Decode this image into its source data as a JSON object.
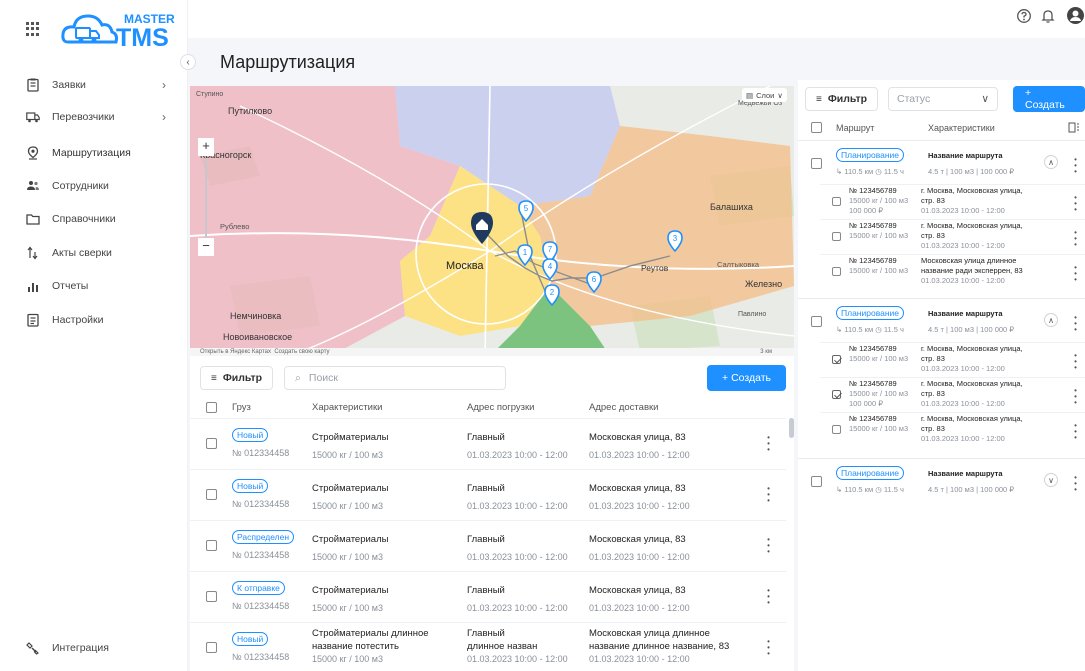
{
  "brand": {
    "logo_top": "MASTER",
    "logo_bottom": "TMS"
  },
  "sidebar": {
    "items": [
      {
        "label": "Заявки",
        "icon": "clipboard-icon",
        "has_arrow": true
      },
      {
        "label": "Перевозчики",
        "icon": "truck-icon",
        "has_arrow": true
      },
      {
        "label": "Маршрутизация",
        "icon": "location-pin-icon",
        "has_arrow": false
      },
      {
        "label": "Сотрудники",
        "icon": "people-icon",
        "has_arrow": false
      },
      {
        "label": "Справочники",
        "icon": "folder-icon",
        "has_arrow": false
      },
      {
        "label": "Акты сверки",
        "icon": "sort-arrows-icon",
        "has_arrow": false
      },
      {
        "label": "Отчеты",
        "icon": "bar-chart-icon",
        "has_arrow": false
      },
      {
        "label": "Настройки",
        "icon": "settings-list-icon",
        "has_arrow": false
      }
    ],
    "bottom_item": {
      "label": "Интеграция",
      "icon": "integration-icon"
    }
  },
  "page": {
    "title": "Маршрутизация"
  },
  "map": {
    "labels": {
      "putilkovo": "Путилково",
      "krasnogorsk": "Красногорск",
      "moscow": "Москва",
      "balashikha": "Балашиха",
      "reutov": "Реутов",
      "zheleznodorozhny": "Железно",
      "nemchinovka": "Немчиновка",
      "novoivanovskoe": "Новоивановское",
      "rublevo": "Рублево",
      "saltykovka": "Салтыковка",
      "layers": "Слои",
      "scale": "3 км",
      "open_maps": "Открыть в Яндекс Картах",
      "create_own_map": "Создать свою карту",
      "medvezhi": "Медвежьи Оз",
      "stupino": "Ступино",
      "pavlino": "Павлино"
    },
    "markers": [
      "1",
      "2",
      "3",
      "4",
      "5",
      "6",
      "7"
    ],
    "zoom_in": "+",
    "zoom_out": "−"
  },
  "orders": {
    "filter_label": "Фильтр",
    "search_placeholder": "Поиск",
    "create_label": "+ Создать",
    "columns": {
      "cargo": "Груз",
      "specs": "Характеристики",
      "load_addr": "Адрес погрузки",
      "delivery_addr": "Адрес доставки"
    },
    "rows": [
      {
        "status": "Новый",
        "number": "№ 012334458",
        "cargo": "Стройматериалы",
        "cargo2": "",
        "specs": "15000 кг / 100 м3",
        "load": "Главный",
        "load2": "",
        "load_time": "01.03.2023 10:00 - 12:00",
        "delivery": "Московская улица, 83",
        "delivery2": "",
        "delivery_time": "01.03.2023 10:00 - 12:00"
      },
      {
        "status": "Новый",
        "number": "№ 012334458",
        "cargo": "Стройматериалы",
        "cargo2": "",
        "specs": "15000 кг / 100 м3",
        "load": "Главный",
        "load2": "",
        "load_time": "01.03.2023 10:00 - 12:00",
        "delivery": "Московская улица, 83",
        "delivery2": "",
        "delivery_time": "01.03.2023 10:00 - 12:00"
      },
      {
        "status": "Распределен",
        "number": "№ 012334458",
        "cargo": "Стройматериалы",
        "cargo2": "",
        "specs": "15000 кг / 100 м3",
        "load": "Главный",
        "load2": "",
        "load_time": "01.03.2023 10:00 - 12:00",
        "delivery": "Московская улица, 83",
        "delivery2": "",
        "delivery_time": "01.03.2023 10:00 - 12:00"
      },
      {
        "status": "К отправке",
        "number": "№ 012334458",
        "cargo": "Стройматериалы",
        "cargo2": "",
        "specs": "15000 кг / 100 м3",
        "load": "Главный",
        "load2": "",
        "load_time": "01.03.2023 10:00 - 12:00",
        "delivery": "Московская улица, 83",
        "delivery2": "",
        "delivery_time": "01.03.2023 10:00 - 12:00"
      },
      {
        "status": "Новый",
        "number": "№ 012334458",
        "cargo": "Стройматериалы длинное",
        "cargo2": "название потестить",
        "specs": "15000 кг / 100 м3",
        "load": "Главный",
        "load2": "длинное назван",
        "load_time": "01.03.2023 10:00 - 12:00",
        "delivery": "Московская улица длинное",
        "delivery2": "название длинное название, 83",
        "delivery_time": "01.03.2023 10:00 - 12:00"
      }
    ]
  },
  "routes": {
    "filter_label": "Фильтр",
    "status_placeholder": "Статус",
    "create_label": "+ Создать",
    "columns": {
      "route": "Маршрут",
      "specs": "Характеристики"
    },
    "cards": [
      {
        "status": "Планирование",
        "name": "Название маршрута",
        "distance": "110.5 км",
        "duration": "11.5 ч",
        "specs": "4.5 т | 100 м3 | 100 000 ₽",
        "expand": "^",
        "stops": [
          {
            "number": "№ 123456789",
            "weight": "15000 кг / 100 м3",
            "price": "100 000 ₽",
            "addr1": "г. Москва, Московская улица,",
            "addr2": "стр. 83",
            "time": "01.03.2023 10:00 - 12:00",
            "checked": false
          },
          {
            "number": "№ 123456789",
            "weight": "15000 кг / 100 м3",
            "price": "",
            "addr1": "г. Москва, Московская улица,",
            "addr2": "стр. 83",
            "time": "01.03.2023 10:00 - 12:00",
            "checked": false
          },
          {
            "number": "№ 123456789",
            "weight": "15000 кг / 100 м3",
            "price": "",
            "addr1": "Московская улица длинное",
            "addr2": "название ради эксперрен, 83",
            "time": "01.03.2023 10:00 - 12:00",
            "checked": false
          }
        ]
      },
      {
        "status": "Планирование",
        "name": "Название маршрута",
        "distance": "110.5 км",
        "duration": "11.5 ч",
        "specs": "4.5 т | 100 м3 | 100 000 ₽",
        "expand": "^",
        "stops": [
          {
            "number": "№ 123456789",
            "weight": "15000 кг / 100 м3",
            "price": "",
            "addr1": "г. Москва, Московская улица,",
            "addr2": "стр. 83",
            "time": "01.03.2023 10:00 - 12:00",
            "checked": true
          },
          {
            "number": "№ 123456789",
            "weight": "15000 кг / 100 м3",
            "price": "100 000 ₽",
            "addr1": "г. Москва, Московская улица,",
            "addr2": "стр. 83",
            "time": "01.03.2023 10:00 - 12:00",
            "checked": true
          },
          {
            "number": "№ 123456789",
            "weight": "15000 кг / 100 м3",
            "price": "",
            "addr1": "г. Москва, Московская улица,",
            "addr2": "стр. 83",
            "time": "01.03.2023 10:00 - 12:00",
            "checked": false
          }
        ]
      },
      {
        "status": "Планирование",
        "name": "Название маршрута",
        "distance": "110.5 км",
        "duration": "11.5 ч",
        "specs": "4.5 т | 100 м3 | 100 000 ₽",
        "expand": "v",
        "stops": []
      }
    ]
  },
  "colors": {
    "accent": "#1e90ff",
    "zone_pink": "#f3b7c0",
    "zone_yellow": "#fde58a",
    "zone_orange": "#f5c08f",
    "zone_blue": "#c8cdf0",
    "zone_green": "#6fbf73"
  }
}
